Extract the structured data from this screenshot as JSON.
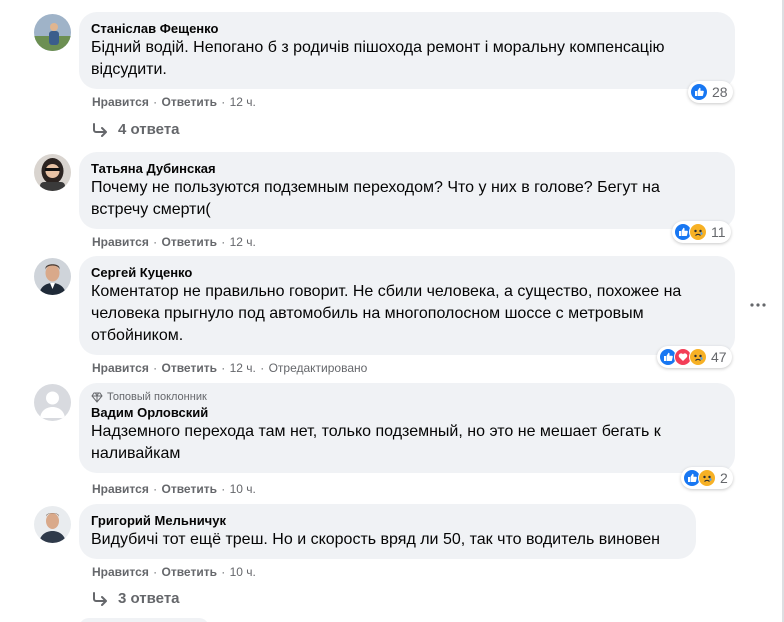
{
  "actions": {
    "like": "Нравится",
    "reply": "Ответить",
    "dot": "·"
  },
  "comments": [
    {
      "author": "Станіслав Фещенко",
      "text_lines": [
        "Бідний водій. Непогано б з родичів пішохода ремонт і моральну компенсацію",
        "відсудити."
      ],
      "time": "12 ч.",
      "edited": "",
      "reactions": [
        "like"
      ],
      "reaction_count": "28",
      "replies": "4 ответа"
    },
    {
      "author": "Татьяна Дубинская",
      "text_lines": [
        "Почему не пользуются подземным переходом? Что у них в голове? Бегут на",
        "встречу смерти("
      ],
      "time": "12 ч.",
      "edited": "",
      "reactions": [
        "like",
        "sad"
      ],
      "reaction_count": "11",
      "replies": ""
    },
    {
      "author": "Сергей Куценко",
      "text_lines": [
        "Коментатор не правильно говорит. Не сбили человека, а существо, похожее на",
        "человека прыгнуло под автомобиль на многополосном шоссе с метровым",
        "отбойником."
      ],
      "time": "12 ч.",
      "edited": "Отредактировано",
      "reactions": [
        "like",
        "love",
        "sad"
      ],
      "reaction_count": "47",
      "replies": ""
    },
    {
      "badge": "Топовый поклонник",
      "author": "Вадим Орловский",
      "text_lines": [
        "Надземного перехода там нет, только подземный, но это не мешает бегать к",
        "наливайкам"
      ],
      "time": "10 ч.",
      "edited": "",
      "reactions": [
        "like",
        "sad"
      ],
      "reaction_count": "2",
      "replies": ""
    },
    {
      "author": "Григорий Мельничук",
      "text_lines": [
        "Видубичі тот ещё треш. Но и скорость вряд ли 50, так что водитель виновен"
      ],
      "time": "10 ч.",
      "edited": "",
      "reactions": [],
      "reaction_count": "",
      "replies": "3 ответа"
    }
  ],
  "colors": {
    "like_blue": "#1877f2",
    "love_red": "#f33e58",
    "sad_yellow": "#f7b125",
    "bubble": "#f0f2f5",
    "muted": "#65676b"
  },
  "icons": {
    "reply_arrow": "reply-arrow-icon",
    "more": "more-horizontal-icon",
    "badge": "diamond-icon"
  }
}
